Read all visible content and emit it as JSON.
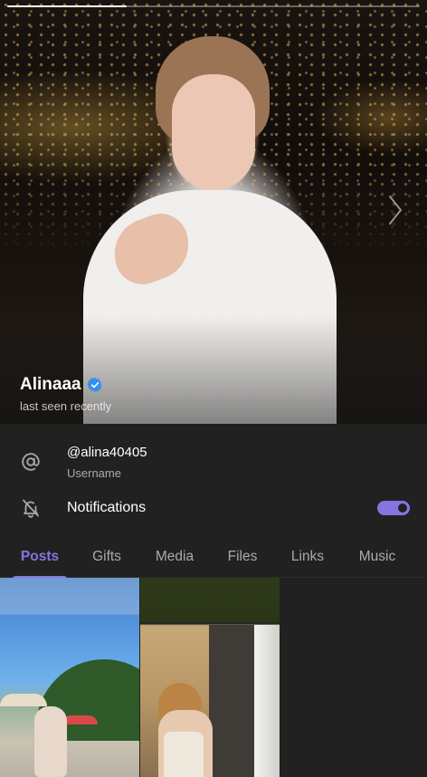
{
  "profile": {
    "name": "Alinaaa",
    "status": "last seen recently",
    "verified": true,
    "photo_progress": 0.29
  },
  "info": {
    "username": {
      "value": "@alina40405",
      "caption": "Username",
      "icon": "at-sign-icon"
    },
    "notifications": {
      "label": "Notifications",
      "icon": "bell-off-icon",
      "enabled": true
    }
  },
  "tabs": [
    {
      "label": "Posts",
      "active": true
    },
    {
      "label": "Gifts",
      "active": false
    },
    {
      "label": "Media",
      "active": false
    },
    {
      "label": "Files",
      "active": false
    },
    {
      "label": "Links",
      "active": false
    },
    {
      "label": "Music",
      "active": false
    }
  ],
  "colors": {
    "accent": "#8774e1",
    "verified": "#3390ec",
    "background": "#212121",
    "secondary_text": "#aaaaaa"
  }
}
